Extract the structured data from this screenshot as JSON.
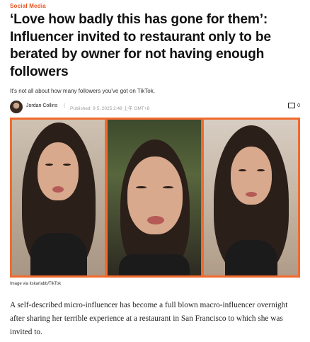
{
  "article": {
    "category": "Social Media",
    "headline": "‘Love how badly this has gone for them’: Influencer invited to restaurant only to be berated by owner for not having enough followers",
    "dek": "It's not all about how many followers you've got on TikTok.",
    "author": "Jordan Collins",
    "separator": "|",
    "published": "Published: 9 5, 2025 2:48 上午 GMT+8",
    "comment_count": "0",
    "image_credit": "Image via itskarlabb/TikTok",
    "body": "A self-described micro-influencer has become a full blown macro-influencer overnight after sharing her terrible experience at a restaurant in San Francisco to which she was invited to."
  },
  "icons": {
    "comment": "comment-icon",
    "avatar": "author-avatar"
  },
  "colors": {
    "accent": "#e8541e",
    "hero_border": "#f26a2d"
  }
}
